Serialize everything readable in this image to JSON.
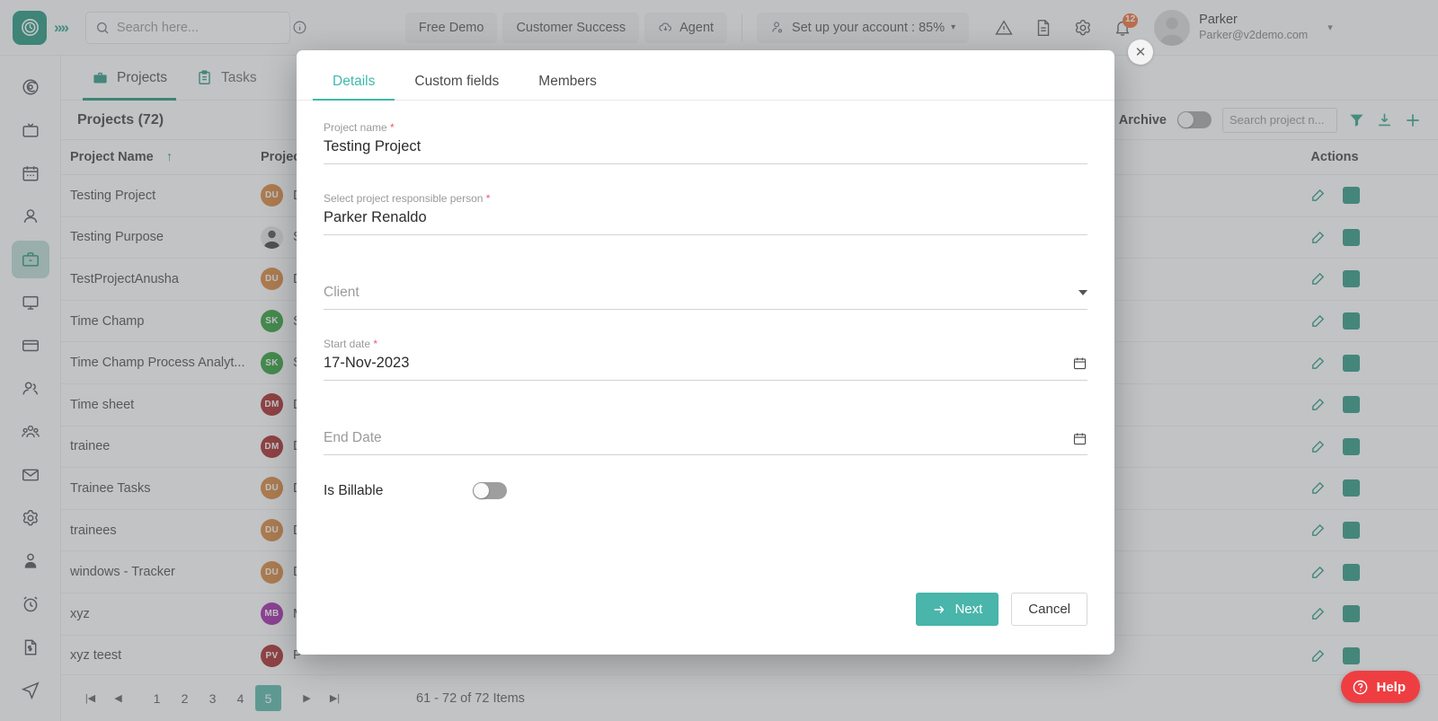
{
  "header": {
    "logo_icon": "clock-logo-icon",
    "expand_icon": "chevrons-right-icon",
    "search_placeholder": "Search here...",
    "search_value": "",
    "search_icon": "search-icon",
    "info_icon": "info-circle-icon",
    "pills": [
      {
        "label": "Free Demo",
        "icon": null
      },
      {
        "label": "Customer Success",
        "icon": null
      },
      {
        "label": "Agent",
        "icon": "cloud-download-icon"
      }
    ],
    "setup": {
      "label": "Set up your account : 85%",
      "icon": "user-settings-icon",
      "caret": "▾"
    },
    "icons": [
      {
        "name": "alert-triangle-icon"
      },
      {
        "name": "document-icon"
      },
      {
        "name": "gear-icon"
      },
      {
        "name": "bell-icon",
        "badge": "12"
      }
    ],
    "profile": {
      "name": "Parker",
      "email": "Parker@v2demo.com",
      "caret": "▾",
      "avatar_icon": "user-avatar-icon"
    }
  },
  "rail": {
    "items": [
      {
        "name": "dashboard-target-icon",
        "active": false
      },
      {
        "name": "tv-monitor-icon",
        "active": false
      },
      {
        "name": "calendar-icon",
        "active": false
      },
      {
        "name": "user-icon",
        "active": false
      },
      {
        "name": "briefcase-projects-icon",
        "active": true
      },
      {
        "name": "desktop-screen-icon",
        "active": false
      },
      {
        "name": "credit-card-icon",
        "active": false
      },
      {
        "name": "users-pair-icon",
        "active": false
      },
      {
        "name": "team-group-icon",
        "active": false
      },
      {
        "name": "mail-envelope-icon",
        "active": false
      },
      {
        "name": "settings-gear-icon",
        "active": false
      },
      {
        "name": "person-badge-icon",
        "active": false
      },
      {
        "name": "alarm-clock-icon",
        "active": false
      },
      {
        "name": "invoice-dollar-icon",
        "active": false
      },
      {
        "name": "send-plane-icon",
        "active": false
      }
    ]
  },
  "content": {
    "tabs": [
      {
        "label": "Projects",
        "icon": "briefcase-icon",
        "active": true
      },
      {
        "label": "Tasks",
        "icon": "clipboard-icon",
        "active": false
      }
    ],
    "subtitle": "Projects  (72)",
    "archive_label": "Archive",
    "archive_on": false,
    "project_search_placeholder": "Search project n...",
    "project_search_value": "",
    "toolbar_icons": [
      {
        "name": "filter-funnel-icon"
      },
      {
        "name": "download-icon"
      },
      {
        "name": "plus-add-icon"
      }
    ],
    "table": {
      "columns": [
        "Project Name",
        "Project",
        "Actions"
      ],
      "sort_indicator": "↑",
      "rows": [
        {
          "name": "Testing Project",
          "initials": "DU",
          "color": "#d87b28",
          "person": "D",
          "photo": false
        },
        {
          "name": "Testing Purpose",
          "initials": "",
          "color": "#e8e8e8",
          "person": "S",
          "photo": true
        },
        {
          "name": "TestProjectAnusha",
          "initials": "DU",
          "color": "#d87b28",
          "person": "D",
          "photo": false
        },
        {
          "name": "Time Champ",
          "initials": "SK",
          "color": "#1b9624",
          "person": "S",
          "photo": false
        },
        {
          "name": "Time Champ Process Analyt...",
          "initials": "SK",
          "color": "#1b9624",
          "person": "S",
          "photo": false
        },
        {
          "name": "Time sheet",
          "initials": "DM",
          "color": "#a11212",
          "person": "D",
          "photo": false
        },
        {
          "name": "trainee",
          "initials": "DM",
          "color": "#a11212",
          "person": "D",
          "photo": false
        },
        {
          "name": "Trainee Tasks",
          "initials": "DU",
          "color": "#d87b28",
          "person": "D",
          "photo": false
        },
        {
          "name": "trainees",
          "initials": "DU",
          "color": "#d87b28",
          "person": "D",
          "photo": false
        },
        {
          "name": "windows - Tracker",
          "initials": "DU",
          "color": "#d87b28",
          "person": "D",
          "photo": false
        },
        {
          "name": "xyz",
          "initials": "MB",
          "color": "#9c11a1",
          "person": "M",
          "photo": false
        },
        {
          "name": "xyz teest",
          "initials": "PV",
          "color": "#a11212",
          "person": "P",
          "photo": false
        }
      ],
      "row_action_icons": [
        {
          "name": "edit-pencil-icon"
        },
        {
          "name": "archive-box-icon"
        }
      ]
    },
    "pagination": {
      "first_label": "|◀",
      "prev_label": "◀",
      "pages": [
        "1",
        "2",
        "3",
        "4",
        "5"
      ],
      "active_page": "5",
      "next_label": "▶",
      "last_label": "▶|",
      "items_label": "61 - 72 of 72 Items"
    }
  },
  "help_fab": {
    "label": "Help",
    "icon": "question-circle-icon"
  },
  "modal": {
    "close_icon": "close-x-icon",
    "tabs": [
      {
        "label": "Details",
        "active": true
      },
      {
        "label": "Custom fields",
        "active": false
      },
      {
        "label": "Members",
        "active": false
      }
    ],
    "fields": {
      "project_name": {
        "label": "Project name",
        "required": true,
        "value": "Testing Project"
      },
      "responsible": {
        "label": "Select project responsible person",
        "required": true,
        "value": "Parker Renaldo"
      },
      "client": {
        "label": "",
        "required": false,
        "placeholder": "Client",
        "value": "",
        "icon": "chevron-down-icon"
      },
      "start_date": {
        "label": "Start date",
        "required": true,
        "value": "17-Nov-2023",
        "icon": "calendar-icon"
      },
      "end_date": {
        "label": "",
        "required": false,
        "placeholder": "End Date",
        "value": "",
        "icon": "calendar-icon"
      },
      "is_billable": {
        "label": "Is Billable",
        "value": false
      }
    },
    "buttons": {
      "next": {
        "label": "Next",
        "icon": "arrow-right-icon"
      },
      "cancel": {
        "label": "Cancel"
      }
    }
  },
  "colors": {
    "brand_teal": "#0d8b6f",
    "modal_accent": "#3fb8ab",
    "next_button": "#49b5ab",
    "help_red": "#ef3e42",
    "badge_orange": "#f26122"
  }
}
